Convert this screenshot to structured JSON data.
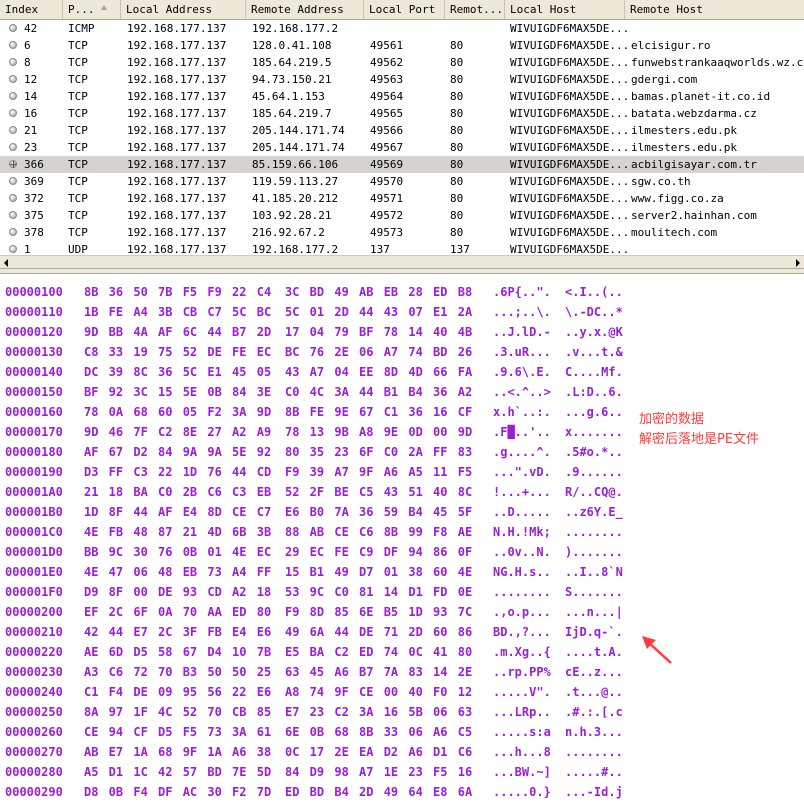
{
  "connections": {
    "columns": [
      {
        "label": "Index"
      },
      {
        "label": "P..."
      },
      {
        "label": "Local Address"
      },
      {
        "label": "Remote Address"
      },
      {
        "label": "Local Port"
      },
      {
        "label": "Remot..."
      },
      {
        "label": "Local Host"
      },
      {
        "label": "Remote Host"
      }
    ],
    "rows": [
      {
        "icon": "circle",
        "index": "42",
        "proto": "ICMP",
        "local_addr": "192.168.177.137",
        "remote_addr": "192.168.177.2",
        "local_port": "",
        "remote_port": "",
        "local_host": "WIVUIGDF6MAX5DE...",
        "remote_host": ""
      },
      {
        "icon": "circle",
        "index": "6",
        "proto": "TCP",
        "local_addr": "192.168.177.137",
        "remote_addr": "128.0.41.108",
        "local_port": "49561",
        "remote_port": "80",
        "local_host": "WIVUIGDF6MAX5DE...",
        "remote_host": "elcisigur.ro"
      },
      {
        "icon": "circle",
        "index": "8",
        "proto": "TCP",
        "local_addr": "192.168.177.137",
        "remote_addr": "185.64.219.5",
        "local_port": "49562",
        "remote_port": "80",
        "local_host": "WIVUIGDF6MAX5DE...",
        "remote_host": "funwebstrankaaqworlds.wz.cz"
      },
      {
        "icon": "circle",
        "index": "12",
        "proto": "TCP",
        "local_addr": "192.168.177.137",
        "remote_addr": "94.73.150.21",
        "local_port": "49563",
        "remote_port": "80",
        "local_host": "WIVUIGDF6MAX5DE...",
        "remote_host": "gdergi.com"
      },
      {
        "icon": "circle",
        "index": "14",
        "proto": "TCP",
        "local_addr": "192.168.177.137",
        "remote_addr": "45.64.1.153",
        "local_port": "49564",
        "remote_port": "80",
        "local_host": "WIVUIGDF6MAX5DE...",
        "remote_host": "bamas.planet-it.co.id"
      },
      {
        "icon": "circle",
        "index": "16",
        "proto": "TCP",
        "local_addr": "192.168.177.137",
        "remote_addr": "185.64.219.7",
        "local_port": "49565",
        "remote_port": "80",
        "local_host": "WIVUIGDF6MAX5DE...",
        "remote_host": "batata.webzdarma.cz"
      },
      {
        "icon": "circle",
        "index": "21",
        "proto": "TCP",
        "local_addr": "192.168.177.137",
        "remote_addr": "205.144.171.74",
        "local_port": "49566",
        "remote_port": "80",
        "local_host": "WIVUIGDF6MAX5DE...",
        "remote_host": "ilmesters.edu.pk"
      },
      {
        "icon": "circle",
        "index": "23",
        "proto": "TCP",
        "local_addr": "192.168.177.137",
        "remote_addr": "205.144.171.74",
        "local_port": "49567",
        "remote_port": "80",
        "local_host": "WIVUIGDF6MAX5DE...",
        "remote_host": "ilmesters.edu.pk"
      },
      {
        "icon": "globe",
        "index": "366",
        "proto": "TCP",
        "local_addr": "192.168.177.137",
        "remote_addr": "85.159.66.106",
        "local_port": "49569",
        "remote_port": "80",
        "local_host": "WIVUIGDF6MAX5DE...",
        "remote_host": "acbilgisayar.com.tr",
        "selected": true
      },
      {
        "icon": "circle",
        "index": "369",
        "proto": "TCP",
        "local_addr": "192.168.177.137",
        "remote_addr": "119.59.113.27",
        "local_port": "49570",
        "remote_port": "80",
        "local_host": "WIVUIGDF6MAX5DE...",
        "remote_host": "sgw.co.th"
      },
      {
        "icon": "circle",
        "index": "372",
        "proto": "TCP",
        "local_addr": "192.168.177.137",
        "remote_addr": "41.185.20.212",
        "local_port": "49571",
        "remote_port": "80",
        "local_host": "WIVUIGDF6MAX5DE...",
        "remote_host": "www.figg.co.za"
      },
      {
        "icon": "circle",
        "index": "375",
        "proto": "TCP",
        "local_addr": "192.168.177.137",
        "remote_addr": "103.92.28.21",
        "local_port": "49572",
        "remote_port": "80",
        "local_host": "WIVUIGDF6MAX5DE...",
        "remote_host": "server2.hainhan.com"
      },
      {
        "icon": "circle",
        "index": "378",
        "proto": "TCP",
        "local_addr": "192.168.177.137",
        "remote_addr": "216.92.67.2",
        "local_port": "49573",
        "remote_port": "80",
        "local_host": "WIVUIGDF6MAX5DE...",
        "remote_host": "moulitech.com"
      },
      {
        "icon": "circle",
        "index": "1",
        "proto": "UDP",
        "local_addr": "192.168.177.137",
        "remote_addr": "192.168.177.2",
        "local_port": "137",
        "remote_port": "137",
        "local_host": "WIVUIGDF6MAX5DE...",
        "remote_host": ""
      }
    ]
  },
  "hex": {
    "color": "#9a1fd6",
    "top_fragment": "-",
    "lines": [
      {
        "offset": "00000100",
        "bytes1": "8B 36 50 7B F5 F9 22 C4",
        "bytes2": "3C BD 49 AB EB 28 ED B8",
        "ascii1": ".6P{..\".",
        "ascii2": "<.I..(.."
      },
      {
        "offset": "00000110",
        "bytes1": "1B FE A4 3B CB C7 5C BC",
        "bytes2": "5C 01 2D 44 43 07 E1 2A",
        "ascii1": "...;..\\.",
        "ascii2": "\\.-DC..*"
      },
      {
        "offset": "00000120",
        "bytes1": "9D BB 4A AF 6C 44 B7 2D",
        "bytes2": "17 04 79 BF 78 14 40 4B",
        "ascii1": "..J.lD.-",
        "ascii2": "..y.x.@K"
      },
      {
        "offset": "00000130",
        "bytes1": "C8 33 19 75 52 DE FE EC",
        "bytes2": "BC 76 2E 06 A7 74 BD 26",
        "ascii1": ".3.uR...",
        "ascii2": ".v...t.&"
      },
      {
        "offset": "00000140",
        "bytes1": "DC 39 8C 36 5C E1 45 05",
        "bytes2": "43 A7 04 EE 8D 4D 66 FA",
        "ascii1": ".9.6\\.E.",
        "ascii2": "C....Mf."
      },
      {
        "offset": "00000150",
        "bytes1": "BF 92 3C 15 5E 0B 84 3E",
        "bytes2": "C0 4C 3A 44 B1 B4 36 A2",
        "ascii1": "..<.^..>",
        "ascii2": ".L:D..6."
      },
      {
        "offset": "00000160",
        "bytes1": "78 0A 68 60 05 F2 3A 9D",
        "bytes2": "8B FE 9E 67 C1 36 16 CF",
        "ascii1": "x.h`..:.",
        "ascii2": "...g.6.."
      },
      {
        "offset": "00000170",
        "bytes1": "9D 46 7F C2 8E 27 A2 A9",
        "bytes2": "78 13 9B A8 9E 0D 00 9D",
        "ascii1": ".F█..'..",
        "ascii2": "x......."
      },
      {
        "offset": "00000180",
        "bytes1": "AF 67 D2 84 9A 9A 5E 92",
        "bytes2": "80 35 23 6F C0 2A FF 83",
        "ascii1": ".g....^.",
        "ascii2": ".5#o.*.."
      },
      {
        "offset": "00000190",
        "bytes1": "D3 FF C3 22 1D 76 44 CD",
        "bytes2": "F9 39 A7 9F A6 A5 11 F5",
        "ascii1": "...\".vD.",
        "ascii2": ".9......"
      },
      {
        "offset": "000001A0",
        "bytes1": "21 18 BA C0 2B C6 C3 EB",
        "bytes2": "52 2F BE C5 43 51 40 8C",
        "ascii1": "!...+...",
        "ascii2": "R/..CQ@."
      },
      {
        "offset": "000001B0",
        "bytes1": "1D 8F 44 AF E4 8D CE C7",
        "bytes2": "E6 B0 7A 36 59 B4 45 5F",
        "ascii1": "..D.....",
        "ascii2": "..z6Y.E_"
      },
      {
        "offset": "000001C0",
        "bytes1": "4E FB 48 87 21 4D 6B 3B",
        "bytes2": "88 AB CE C6 8B 99 F8 AE",
        "ascii1": "N.H.!Mk;",
        "ascii2": "........"
      },
      {
        "offset": "000001D0",
        "bytes1": "BB 9C 30 76 0B 01 4E EC",
        "bytes2": "29 EC FE C9 DF 94 86 0F",
        "ascii1": "..0v..N.",
        "ascii2": ")......."
      },
      {
        "offset": "000001E0",
        "bytes1": "4E 47 06 48 EB 73 A4 FF",
        "bytes2": "15 B1 49 D7 01 38 60 4E",
        "ascii1": "NG.H.s..",
        "ascii2": "..I..8`N"
      },
      {
        "offset": "000001F0",
        "bytes1": "D9 8F 00 DE 93 CD A2 18",
        "bytes2": "53 9C C0 81 14 D1 FD 0E",
        "ascii1": "........",
        "ascii2": "S......."
      },
      {
        "offset": "00000200",
        "bytes1": "EF 2C 6F 0A 70 AA ED 80",
        "bytes2": "F9 8D 85 6E B5 1D 93 7C",
        "ascii1": ".,o.p...",
        "ascii2": "...n...|"
      },
      {
        "offset": "00000210",
        "bytes1": "42 44 E7 2C 3F FB E4 E6",
        "bytes2": "49 6A 44 DE 71 2D 60 86",
        "ascii1": "BD.,?...",
        "ascii2": "IjD.q-`."
      },
      {
        "offset": "00000220",
        "bytes1": "AE 6D D5 58 67 D4 10 7B",
        "bytes2": "E5 BA C2 ED 74 0C 41 80",
        "ascii1": ".m.Xg..{",
        "ascii2": "....t.A."
      },
      {
        "offset": "00000230",
        "bytes1": "A3 C6 72 70 B3 50 50 25",
        "bytes2": "63 45 A6 B7 7A 83 14 2E",
        "ascii1": "..rp.PP%",
        "ascii2": "cE..z..."
      },
      {
        "offset": "00000240",
        "bytes1": "C1 F4 DE 09 95 56 22 E6",
        "bytes2": "A8 74 9F CE 00 40 F0 12",
        "ascii1": ".....V\".",
        "ascii2": ".t...@.."
      },
      {
        "offset": "00000250",
        "bytes1": "8A 97 1F 4C 52 70 CB 85",
        "bytes2": "E7 23 C2 3A 16 5B 06 63",
        "ascii1": "...LRp..",
        "ascii2": ".#.:.[.c"
      },
      {
        "offset": "00000260",
        "bytes1": "CE 94 CF D5 F5 73 3A 61",
        "bytes2": "6E 0B 68 8B 33 06 A6 C5",
        "ascii1": ".....s:a",
        "ascii2": "n.h.3..."
      },
      {
        "offset": "00000270",
        "bytes1": "AB E7 1A 68 9F 1A A6 38",
        "bytes2": "0C 17 2E EA D2 A6 D1 C6",
        "ascii1": "...h...8",
        "ascii2": "........"
      },
      {
        "offset": "00000280",
        "bytes1": "A5 D1 1C 42 57 BD 7E 5D",
        "bytes2": "84 D9 98 A7 1E 23 F5 16",
        "ascii1": "...BW.~]",
        "ascii2": ".....#.."
      },
      {
        "offset": "00000290",
        "bytes1": "D8 0B F4 DF AC 30 F2 7D",
        "bytes2": "ED BD B4 2D 49 64 E8 6A",
        "ascii1": ".....0.}",
        "ascii2": "...-Id.j"
      }
    ]
  },
  "annotation": {
    "line1": "加密的数据",
    "line2": "解密后落地是PE文件",
    "color": "#ff3b3b"
  }
}
